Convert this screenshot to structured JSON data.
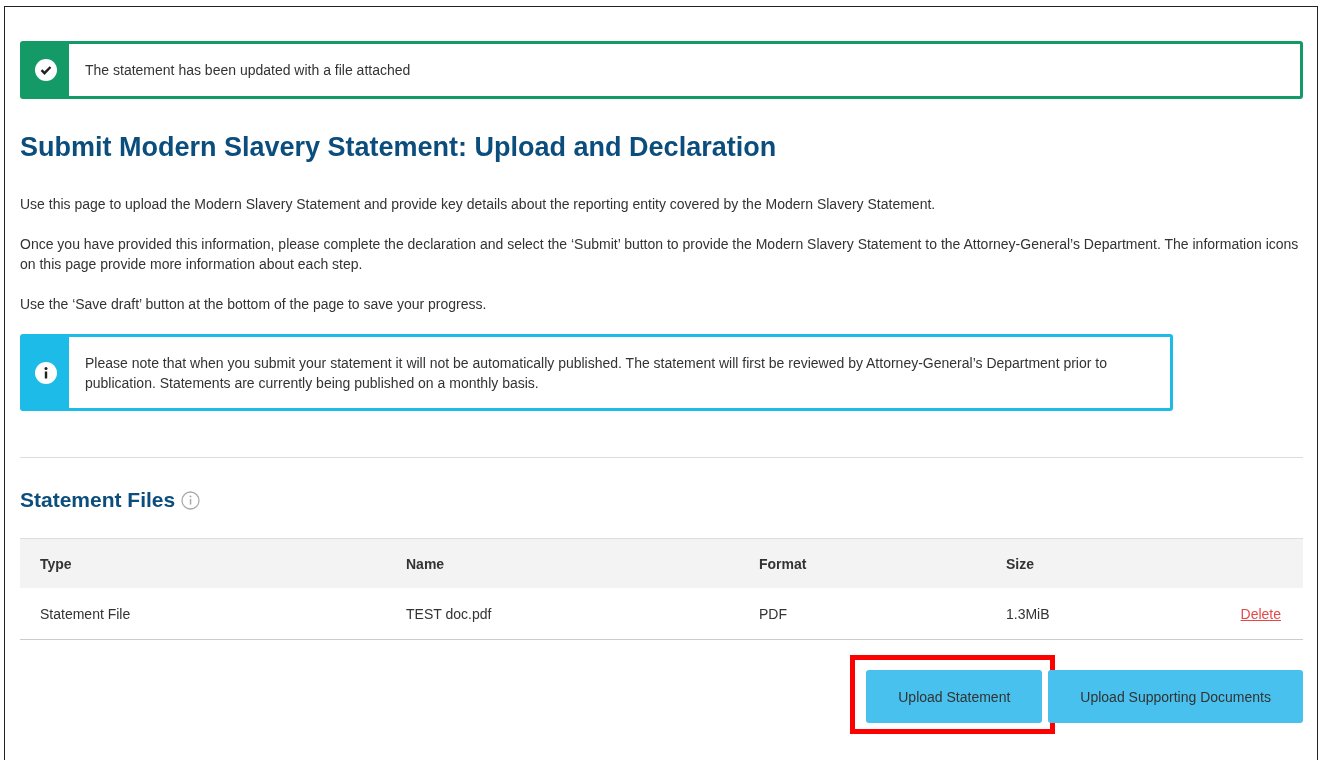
{
  "success_banner": {
    "text": "The statement has been updated with a file attached"
  },
  "title": "Submit Modern Slavery Statement: Upload and Declaration",
  "paragraphs": [
    "Use this page to upload the Modern Slavery Statement and provide key details about the reporting entity covered by the Modern Slavery Statement.",
    "Once you have provided this information, please complete the declaration and select the ‘Submit’ button to provide the Modern Slavery Statement to the Attorney-General’s Department. The information icons on this page provide more information about each step.",
    "Use the ‘Save draft’ button at the bottom of the page to save your progress."
  ],
  "info_banner": {
    "text": "Please note that when you submit your statement it will not be automatically published. The statement will first be reviewed by Attorney-General’s Department prior to publication. Statements are currently being published on a monthly basis."
  },
  "section": {
    "title": "Statement Files"
  },
  "table": {
    "columns": [
      "Type",
      "Name",
      "Format",
      "Size"
    ],
    "rows": [
      {
        "cells": [
          "Statement File",
          "TEST doc.pdf",
          "PDF",
          "1.3MiB"
        ],
        "action": "Delete"
      }
    ]
  },
  "buttons": [
    {
      "label": "Upload Statement",
      "highlighted": true
    },
    {
      "label": "Upload Supporting Documents",
      "highlighted": false
    }
  ]
}
